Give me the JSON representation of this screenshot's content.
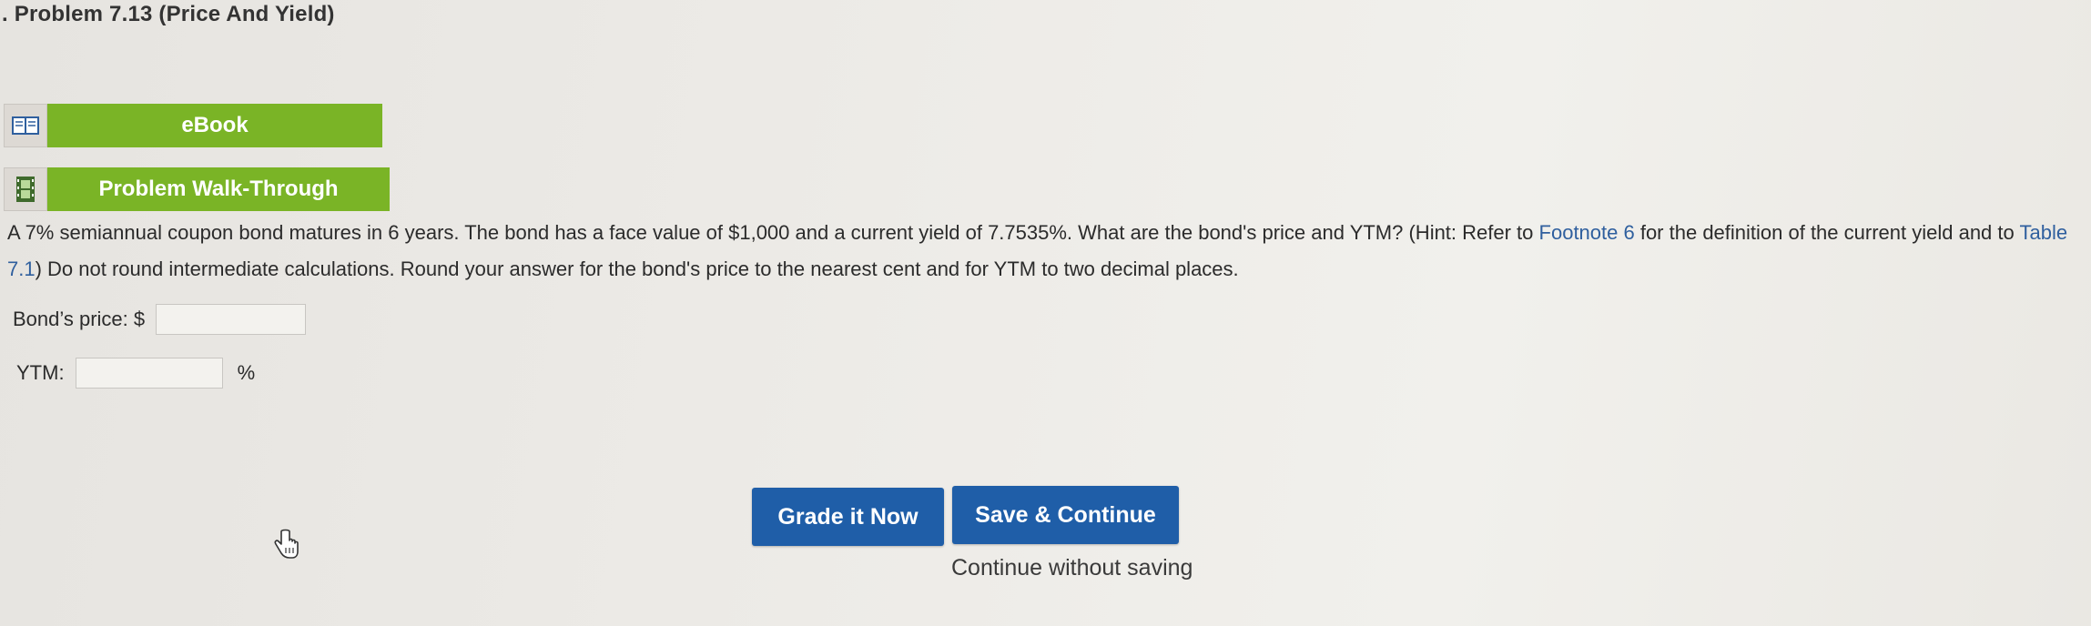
{
  "header": {
    "title": ". Problem 7.13 (Price And Yield)"
  },
  "resources": {
    "ebook_label": "eBook",
    "walkthrough_label": "Problem Walk-Through"
  },
  "problem": {
    "text_part1": "A 7% semiannual coupon bond matures in 6 years. The bond has a face value of $1,000 and a current yield of 7.7535%. What are the bond's price and YTM? (Hint: Refer to ",
    "footnote_link": "Footnote 6",
    "text_part2": " for the definition of the current yield and to ",
    "table_link": "Table 7.1",
    "text_part3": ") Do not round intermediate calculations. Round your answer for the bond's price to the nearest cent and for YTM to two decimal places."
  },
  "fields": {
    "price_label": "Bond’s price: $",
    "price_value": "",
    "ytm_label": "YTM:",
    "ytm_value": "",
    "ytm_unit": "%"
  },
  "actions": {
    "grade_label": "Grade it Now",
    "save_label": "Save & Continue",
    "continue_label": "Continue without saving"
  },
  "colors": {
    "resource_green": "#7ab426",
    "button_blue": "#1f5ea8",
    "link_blue": "#2f5f9e"
  }
}
